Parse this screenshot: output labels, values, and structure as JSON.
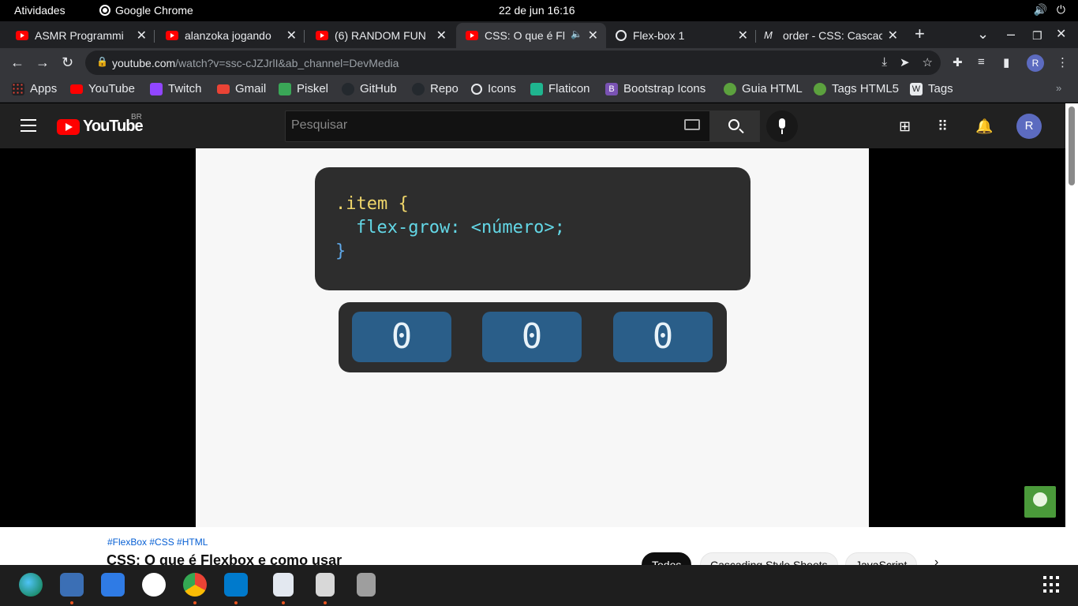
{
  "system": {
    "activities": "Atividades",
    "app_name": "Google Chrome",
    "clock": "22 de jun  16:16"
  },
  "tabs": [
    {
      "title": "ASMR Programmi",
      "icon": "youtube-icon",
      "active": false
    },
    {
      "title": "alanzoka jogando",
      "icon": "youtube-icon",
      "active": false
    },
    {
      "title": "(6) RANDOM FUN",
      "icon": "youtube-icon",
      "active": false
    },
    {
      "title": "CSS: O que é Fl",
      "icon": "youtube-icon",
      "active": true
    },
    {
      "title": "Flex-box 1",
      "icon": "globe-icon",
      "active": false
    },
    {
      "title": "order - CSS: Cascac",
      "icon": "mdn-icon",
      "active": false
    }
  ],
  "omnibox": {
    "url_host": "youtube.com",
    "url_rest": "/watch?v=ssc-cJZJrlI&ab_channel=DevMedia"
  },
  "bookmarks": [
    {
      "label": "Apps",
      "color": "#4285f4"
    },
    {
      "label": "YouTube",
      "color": "#ff0000"
    },
    {
      "label": "Twitch",
      "color": "#9146ff"
    },
    {
      "label": "Gmail",
      "color": "#ea4335"
    },
    {
      "label": "Piskel",
      "color": "#3aa757"
    },
    {
      "label": "GitHub",
      "color": "#24292e"
    },
    {
      "label": "Repo",
      "color": "#24292e"
    },
    {
      "label": "Icons",
      "color": "#e8eaed"
    },
    {
      "label": "Flaticon",
      "color": "#1fb58f"
    },
    {
      "label": "Bootstrap Icons",
      "color": "#7952b3"
    },
    {
      "label": "Guia HTML",
      "color": "#5ca13e"
    },
    {
      "label": "Tags HTML5",
      "color": "#5ca13e"
    },
    {
      "label": "Tags",
      "color": "#e8eaed"
    }
  ],
  "youtube": {
    "logo_text": "YouTube",
    "country_code": "BR",
    "search_placeholder": "Pesquisar",
    "avatar_letter": "R"
  },
  "video": {
    "code_line1": ".item {",
    "code_line2": "flex-grow: <número>;",
    "code_line3": "}",
    "items": [
      "0",
      "0",
      "0"
    ]
  },
  "below_video": {
    "tags": "#FlexBox #CSS #HTML",
    "title": "CSS: O que é Flexbox e como usar",
    "chips": [
      "Todos",
      "Cascading Style Sheets",
      "JavaScript"
    ]
  },
  "profile_letter": "R"
}
